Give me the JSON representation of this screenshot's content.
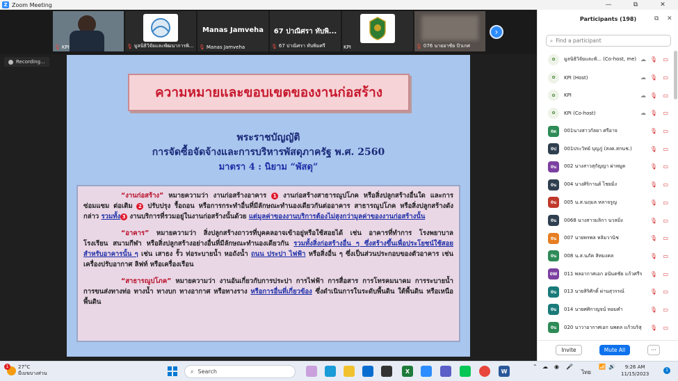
{
  "window": {
    "title": "Zoom Meeting",
    "minimize": "—",
    "maximize": "⧉",
    "close": "✕"
  },
  "thumbnails": [
    {
      "label": "KPI",
      "big": ""
    },
    {
      "label": "มูลนิธิวิจัยและพัฒนาการพิ...",
      "big": ""
    },
    {
      "label": "Manas Jamveha",
      "big": "Manas Jamveha"
    },
    {
      "label": "67 ปาณิศรา ทับพิมศรี",
      "big": "67 ปาณิศรา ทับพิ..."
    },
    {
      "label": "KPI",
      "big": ""
    },
    {
      "label": "076 นายอาชัย ปัวเกศ",
      "big": ""
    }
  ],
  "recording": {
    "label": "Recording..."
  },
  "slide": {
    "title": "ความหมายและขอบเขตของงานก่อสร้าง",
    "act_line1": "พระราชบัญญัติ",
    "act_line2": "การจัดซื้อจัดจ้างและการบริหารพัสดุภาครัฐ พ.ศ. 2560",
    "act_line3": "มาตรา 4 : นิยาม “พัสดุ”",
    "badges": [
      "1",
      "2",
      "3"
    ],
    "p1": {
      "term": "“งานก่อสร้าง”",
      "a": " หมายความว่า งานก่อสร้างอาคาร ",
      "b": " งานก่อสร้างสาธารณูปโภค หรือสิ่งปลูกสร้างอื่นใด และการซ่อมแซม ต่อเติม ",
      "c": " ปรับปรุง รื้อถอน หรือการกระทำอื่นที่มีลักษณะทำนองเดียวกันต่ออาคาร สาธารณูปโภค หรือสิ่งปลูกสร้างดังกล่าว ",
      "d": "รวมทั้ง",
      "e": " งานบริการที่รวมอยู่ในงานก่อสร้างนั้นด้วย ",
      "f": "แต่มูลค่าของงานบริการต้องไม่สูงกว่ามูลค่าของงานก่อสร้างนั้น"
    },
    "p2": {
      "term": "“อาคาร”",
      "a": " หมายความว่า สิ่งปลูกสร้างถาวรที่บุคคลอาจเข้าอยู่หรือใช้สอยได้ เช่น อาคารที่ทำการ โรงพยาบาล โรงเรียน สนามกีฬา หรือสิ่งปลูกสร้างอย่างอื่นที่มีลักษณะทำนองเดียวกัน ",
      "b": "รวมทั้งสิ่งก่อสร้างอื่น ๆ ซึ่งสร้างขึ้นเพื่อประโยชน์ใช้สอยสำหรับอาคารนั้น ๆ",
      "c": " เช่น เสาธง รั้ว ท่อระบายน้ำ หอถังน้ำ ",
      "d": "ถนน ประปา ไฟฟ้า",
      "e": " หรือสิ่งอื่น ๆ ซึ่งเป็นส่วนประกอบของตัวอาคาร เช่น เครื่องปรับอากาศ ลิฟท์ หรือเครื่องเรือน"
    },
    "p3": {
      "term": "“สาธารณูปโภค”",
      "a": " หมายความว่า งานอันเกี่ยวกับการประปา การไฟฟ้า การสื่อสาร การโทรคมนาคม การระบายน้ำ การขนส่งทางท่อ ทางน้ำ ทางบก ทางอากาศ หรือทางราง ",
      "b": "หรือการอื่นที่เกี่ยวข้อง",
      "c": " ซึ่งดำเนินการในระดับพื้นดิน ใต้พื้นดิน หรือเหนือพื้นดิน"
    }
  },
  "participants": {
    "title": "Participants (198)",
    "search_placeholder": "Find a participant",
    "rows": [
      {
        "initials": "",
        "name": "มูลนิธิวิจัยและพั...  (Co-host, me)",
        "color": "#eef3e8"
      },
      {
        "initials": "",
        "name": "KPI (Host)",
        "color": "#eef3e8"
      },
      {
        "initials": "",
        "name": "KPI",
        "color": "#eef3e8"
      },
      {
        "initials": "",
        "name": "KPI (Co-host)",
        "color": "#eef3e8"
      },
      {
        "initials": "0ด",
        "name": "001นางสาวกัลยา  ศรีอาจ",
        "color": "#2e8b57"
      },
      {
        "initials": "0ป",
        "name": "001ประวิทย์ บุญภู่ (สงค.สกนช.)",
        "color": "#2f3f4f"
      },
      {
        "initials": "0น",
        "name": "002 นางสาวสุกัญญา ผ่าหมูด",
        "color": "#7b3fa0"
      },
      {
        "initials": "0น",
        "name": "004 นางศิริกานต์ ไชยมิ่ง",
        "color": "#2f3f4f"
      },
      {
        "initials": "0น",
        "name": "005 น.ส.นฤมล หลาจรูญ",
        "color": "#c0392b"
      },
      {
        "initials": "0น",
        "name": "0068 นางสาวมลิกา  นวลมิ่ง",
        "color": "#2f3f4f"
      },
      {
        "initials": "0น",
        "name": "007 นายพรพล หลิมวานิช",
        "color": "#e67e22"
      },
      {
        "initials": "0น",
        "name": "008 น.ส.นภัค สิทมงคล",
        "color": "#2e8b57"
      },
      {
        "initials": "0W",
        "name": "011 พลอากาศเอก อนันตชัย  แก้วศรีราม",
        "color": "#7b3fa0"
      },
      {
        "initials": "0น",
        "name": "013 นายสิริศักดิ์ ผ่านสุวรรณ์",
        "color": "#1a7a7a"
      },
      {
        "initials": "0น",
        "name": "014 นายศศิกาญจน์ หอมคำ",
        "color": "#1a7a7a"
      },
      {
        "initials": "0น",
        "name": "020 นาวาอากาศเอก นพดล  แก้วบริสุ...",
        "color": "#2e8b57"
      }
    ],
    "invite_label": "Invite",
    "mute_all_label": "Mute All",
    "more_label": "···"
  },
  "taskbar": {
    "temp": "27°C",
    "weather_desc": "มีเมฆบางส่วน",
    "notif_count": "1",
    "search_label": "Search",
    "lang": "ไทย",
    "time": "9:26 AM",
    "date": "11/15/2023",
    "clock_badge": "1"
  }
}
